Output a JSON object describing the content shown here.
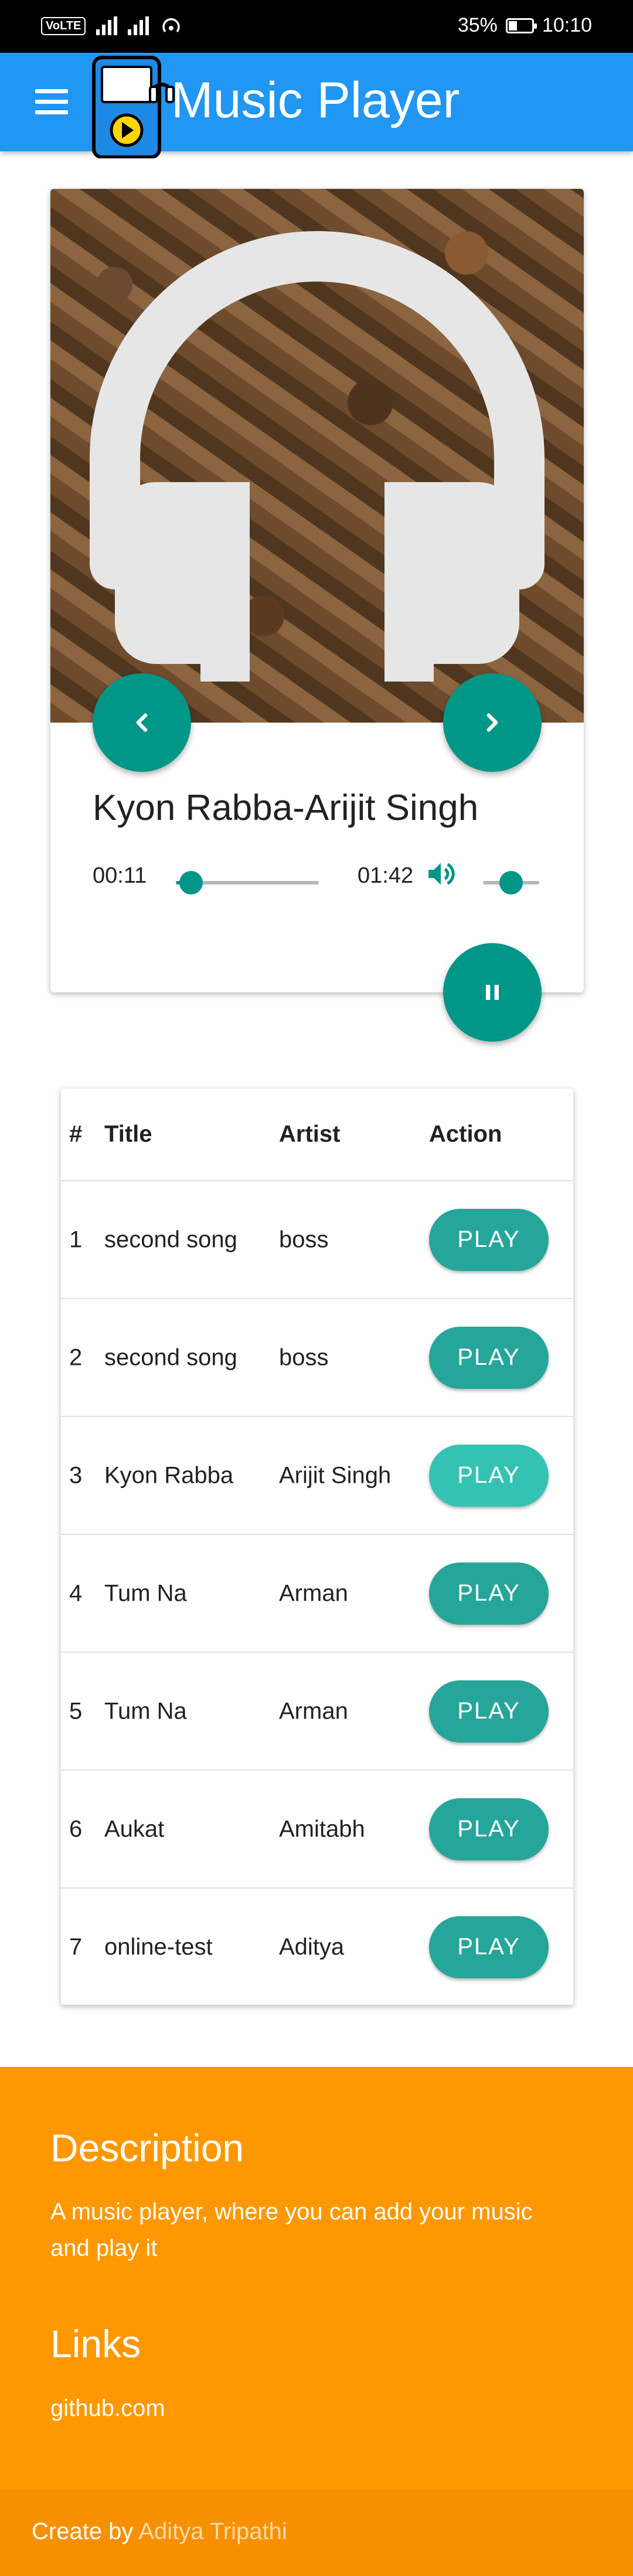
{
  "status_bar": {
    "network_badge": "VoLTE",
    "battery_percent": "35%",
    "battery_level": 0.35,
    "time": "10:10"
  },
  "app_bar": {
    "title": "Music Player",
    "menu_icon": "hamburger-menu-icon",
    "logo_icon": "music-player-logo-icon",
    "color": "#2196f3"
  },
  "player": {
    "album_art_icon": "headphones-icon",
    "song_title": "Kyon Rabba-Arijit Singh",
    "current_time": "00:11",
    "total_time": "01:42",
    "progress": 0.107,
    "volume": 0.5,
    "prev_icon": "chevron-left-icon",
    "next_icon": "chevron-right-icon",
    "pause_icon": "pause-icon",
    "volume_icon": "volume-up-icon",
    "accent": "#009688"
  },
  "playlist": {
    "headers": {
      "num": "#",
      "title": "Title",
      "artist": "Artist",
      "action": "Action"
    },
    "rows": [
      {
        "num": "1",
        "title": "second song",
        "artist": "boss",
        "action": "PLAY"
      },
      {
        "num": "2",
        "title": "second song",
        "artist": "boss",
        "action": "PLAY"
      },
      {
        "num": "3",
        "title": "Kyon Rabba",
        "artist": "Arijit Singh",
        "action": "PLAY"
      },
      {
        "num": "4",
        "title": "Tum Na",
        "artist": "Arman",
        "action": "PLAY"
      },
      {
        "num": "5",
        "title": "Tum Na",
        "artist": "Arman",
        "action": "PLAY"
      },
      {
        "num": "6",
        "title": "Aukat",
        "artist": "Amitabh",
        "action": "PLAY"
      },
      {
        "num": "7",
        "title": "online-test",
        "artist": "Aditya",
        "action": "PLAY"
      }
    ],
    "button_color": "#26a69a"
  },
  "footer": {
    "description_heading": "Description",
    "description": "A music player, where you can add your music and play it",
    "links_heading": "Links",
    "link": "github.com",
    "color": "#ff9800"
  },
  "copyright": {
    "prefix": "Create by ",
    "author": "Aditya Tripathi"
  }
}
